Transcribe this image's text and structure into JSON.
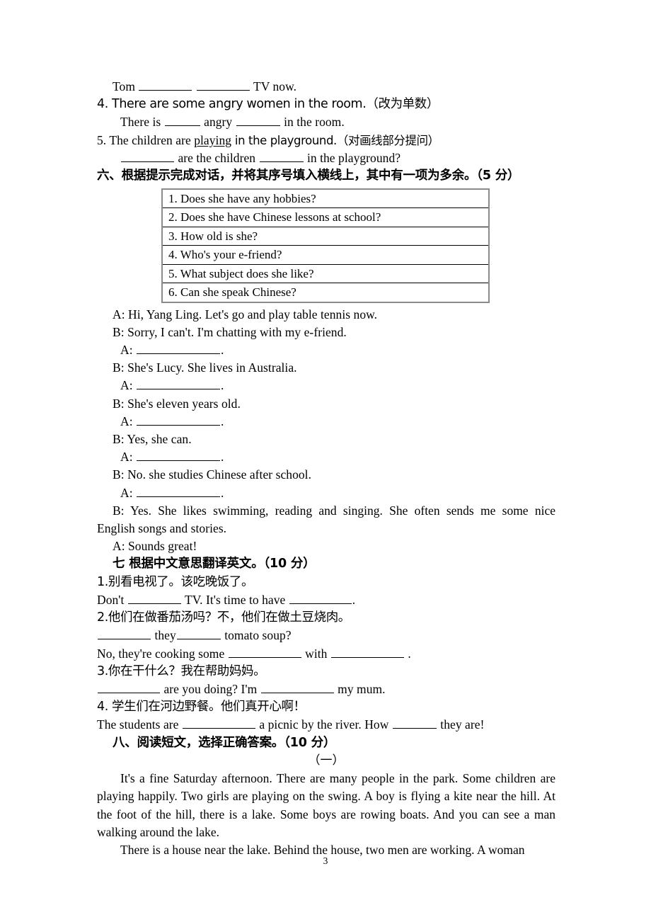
{
  "document": {
    "page_number": "3",
    "type": "english-exam-paper"
  },
  "section5_tail": {
    "q3_answer_line": "Tom",
    "q3_answer_tail": "TV now.",
    "q4_prompt": "4. There are some angry women in the room.（改为单数）",
    "q4_answer_pre": "There is",
    "q4_answer_mid": "angry",
    "q4_answer_tail": "in the room.",
    "q5_prompt_pre": "5. The children are ",
    "q5_prompt_underlined": "playing",
    "q5_prompt_post": " in the playground.（对画线部分提问）",
    "q5_answer_mid": "are the children",
    "q5_answer_tail": "in the playground?"
  },
  "section6": {
    "heading": "六、根据提示完成对话，并将其序号填入横线上，其中有一项为多余。（5 分）",
    "options": [
      "1. Does she have any hobbies?",
      "2. Does she have Chinese lessons at school?",
      "3. How old is she?",
      "4. Who's your e-friend?",
      "5. What subject does she like?",
      "6. Can she speak Chinese?"
    ],
    "dialogue": [
      {
        "speaker": "A:",
        "text": "Hi, Yang Ling. Let's go and play table tennis now.",
        "blank": false
      },
      {
        "speaker": "B:",
        "text": "Sorry, I can't. I'm chatting with my e-friend.",
        "blank": false
      },
      {
        "speaker": "A:",
        "text": ".",
        "blank": true
      },
      {
        "speaker": "B:",
        "text": "She's Lucy. She lives in Australia.",
        "blank": false
      },
      {
        "speaker": "A:",
        "text": ".",
        "blank": true
      },
      {
        "speaker": "B:",
        "text": "She's eleven years old.",
        "blank": false
      },
      {
        "speaker": "A:",
        "text": ".",
        "blank": true
      },
      {
        "speaker": "B:",
        "text": "Yes, she can.",
        "blank": false
      },
      {
        "speaker": "A:",
        "text": ".",
        "blank": true
      },
      {
        "speaker": "B:",
        "text": "No. she studies Chinese after school.",
        "blank": false
      },
      {
        "speaker": "A:",
        "text": ".",
        "blank": true
      }
    ],
    "long_answer_line1": "B: Yes. She likes swimming, reading and singing. She often sends me some nice",
    "long_answer_line2": "English songs and stories.",
    "final_line": "A: Sounds great!"
  },
  "section7": {
    "heading": "七 根据中文意思翻译英文。（10 分）",
    "items": [
      {
        "chinese": "1.别看电视了。该吃晚饭了。",
        "english_pre": "Don't",
        "english_mid": "TV. It's time to have",
        "english_tail": "."
      },
      {
        "chinese": "2.他们在做番茄汤吗？不，他们在做土豆烧肉。",
        "line1_mid": "they",
        "line1_tail": "tomato soup?",
        "line2_pre": "No, they're cooking some",
        "line2_mid": "with",
        "line2_tail": "."
      },
      {
        "chinese": "3.你在干什么？我在帮助妈妈。",
        "english_mid": "are you doing? I'm",
        "english_tail": "my mum."
      },
      {
        "chinese": "4. 学生们在河边野餐。他们真开心啊！",
        "english_pre": "The students are",
        "english_mid": "a picnic by the river. How",
        "english_tail": "they are!"
      }
    ]
  },
  "section8": {
    "heading": "八、阅读短文，选择正确答案。（10 分）",
    "passage_marker": "（一）",
    "paragraph1": "It's a fine Saturday afternoon. There are many people in the park. Some children are playing happily. Two girls are playing on the swing. A boy is flying a kite near the hill. At the foot of the hill, there is a lake. Some boys are rowing boats. And you can see a man walking around the lake.",
    "paragraph2": "There is a house near the lake. Behind the house, two men are working. A woman"
  }
}
